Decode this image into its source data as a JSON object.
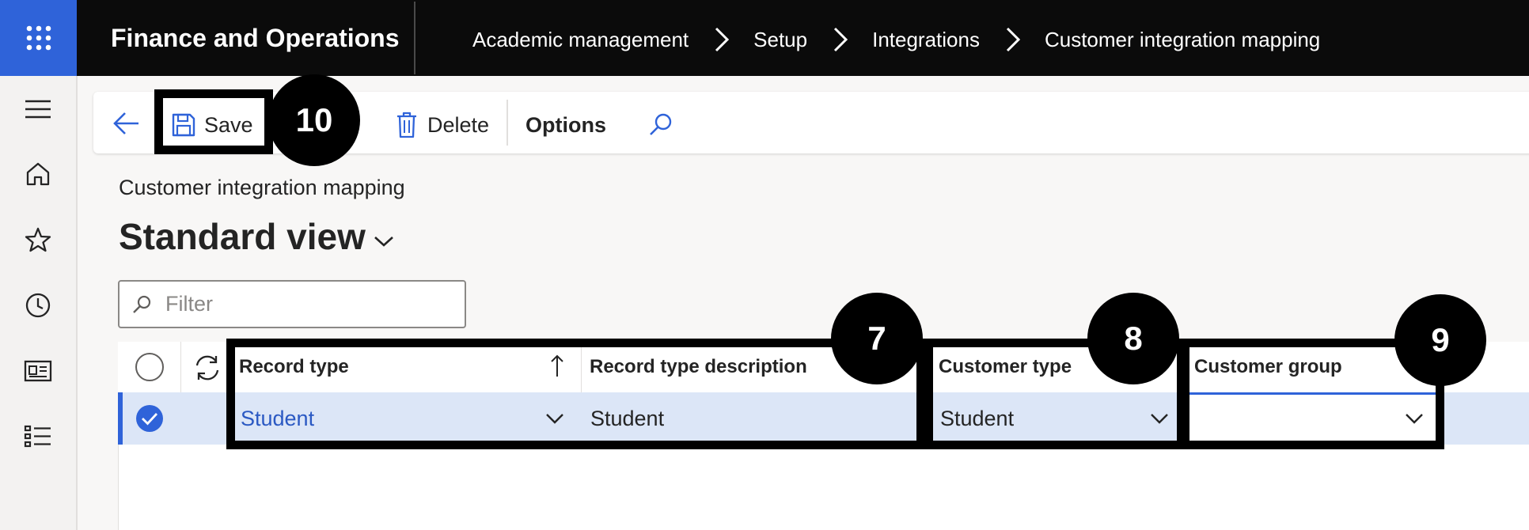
{
  "topbar": {
    "app_title": "Finance and Operations",
    "waffle_icon": "waffle-icon",
    "breadcrumb": [
      "Academic management",
      "Setup",
      "Integrations",
      "Customer integration mapping"
    ]
  },
  "leftnav": {
    "icons": [
      "hamburger-icon",
      "home-icon",
      "star-icon",
      "clock-icon",
      "workspace-icon",
      "list-icon"
    ]
  },
  "actionpane": {
    "save_label": "Save",
    "delete_label": "Delete",
    "options_label": "Options"
  },
  "page": {
    "form_caption": "Customer integration mapping",
    "view_title": "Standard view"
  },
  "filter": {
    "placeholder": "Filter"
  },
  "grid": {
    "columns": {
      "record_type": "Record type",
      "record_type_description": "Record type description",
      "customer_type": "Customer type",
      "customer_group": "Customer group"
    },
    "rows": [
      {
        "record_type": "Student",
        "record_type_description": "Student",
        "customer_type": "Student",
        "customer_group": "",
        "selected": true
      }
    ]
  },
  "callouts": {
    "save": "10",
    "record_type": "7",
    "customer_type": "8",
    "customer_group": "9"
  },
  "colors": {
    "accent": "#2f63d9",
    "topbar": "#0b0b0b",
    "selected_row": "#dce6f7"
  }
}
